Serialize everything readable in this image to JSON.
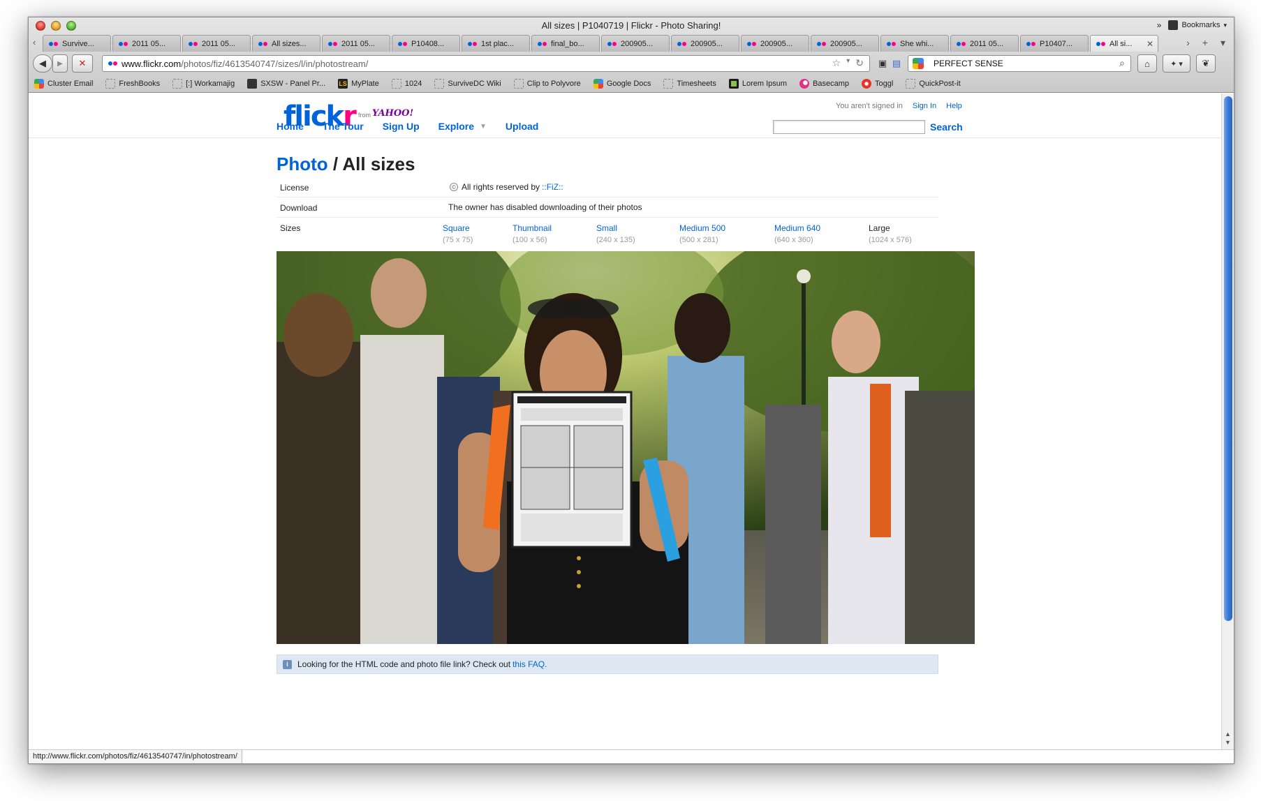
{
  "window": {
    "title": "All sizes | P1040719 | Flickr - Photo Sharing!"
  },
  "tabs": [
    {
      "label": "Survive..."
    },
    {
      "label": "2011 05..."
    },
    {
      "label": "2011 05..."
    },
    {
      "label": "All sizes..."
    },
    {
      "label": "2011 05..."
    },
    {
      "label": "P10408..."
    },
    {
      "label": "1st plac..."
    },
    {
      "label": "final_bo..."
    },
    {
      "label": "200905..."
    },
    {
      "label": "200905..."
    },
    {
      "label": "200905..."
    },
    {
      "label": "200905..."
    },
    {
      "label": "She whi..."
    },
    {
      "label": "2011 05..."
    },
    {
      "label": "P10407..."
    },
    {
      "label": "All si..."
    }
  ],
  "url": {
    "host": "www.flickr.com",
    "path": "/photos/fiz/4613540747/sizes/l/in/photostream/"
  },
  "search": {
    "value": "PERFECT SENSE"
  },
  "bookmarks": [
    {
      "label": "Cluster Email",
      "icon": "google-icon"
    },
    {
      "label": "FreshBooks",
      "icon": "bookmark-icon"
    },
    {
      "label": "[:] Workamajig",
      "icon": "workamajig-icon"
    },
    {
      "label": "SXSW - Panel Pr...",
      "icon": "sxsw-icon"
    },
    {
      "label": "MyPlate",
      "icon": "ls-icon"
    },
    {
      "label": "1024",
      "icon": "bookmark-icon"
    },
    {
      "label": "SurviveDC Wiki",
      "icon": "bookmark-icon"
    },
    {
      "label": "Clip to Polyvore",
      "icon": "bookmark-icon"
    },
    {
      "label": "Google Docs",
      "icon": "google-icon"
    },
    {
      "label": "Timesheets",
      "icon": "bookmark-icon"
    },
    {
      "label": "Lorem Ipsum",
      "icon": "lorem-icon"
    },
    {
      "label": "Basecamp",
      "icon": "basecamp-icon"
    },
    {
      "label": "Toggl",
      "icon": "toggl-icon"
    },
    {
      "label": "QuickPost-it",
      "icon": "bookmark-icon"
    }
  ],
  "bookmarks_menu": "Bookmarks",
  "flickr": {
    "logo_a": "flick",
    "logo_b": "r",
    "from": "from",
    "yahoo": "YAHOO!",
    "signed_out": "You aren't signed in",
    "sign_in": "Sign In",
    "help": "Help",
    "nav": [
      "Home",
      "The Tour",
      "Sign Up",
      "Explore",
      "Upload"
    ],
    "search_button": "Search"
  },
  "page": {
    "crumb": "Photo",
    "sep": " / ",
    "title": "All sizes",
    "license_label": "License",
    "license_text": "All rights reserved by",
    "owner": "::FiZ::",
    "download_label": "Download",
    "download_text": "The owner has disabled downloading of their photos",
    "sizes_label": "Sizes",
    "sizes": [
      {
        "label": "Square",
        "dim": "(75 x 75)"
      },
      {
        "label": "Thumbnail",
        "dim": "(100 x 56)"
      },
      {
        "label": "Small",
        "dim": "(240 x 135)"
      },
      {
        "label": "Medium 500",
        "dim": "(500 x 281)"
      },
      {
        "label": "Medium 640",
        "dim": "(640 x 360)"
      },
      {
        "label": "Large",
        "dim": "(1024 x 576)"
      }
    ],
    "faq_text": "Looking for the HTML code and photo file link? Check out",
    "faq_link": "this FAQ."
  },
  "status_url": "http://www.flickr.com/photos/fiz/4613540747/in/photostream/",
  "colors": {
    "flickr_blue": "#0063dc",
    "flickr_pink": "#ff0084",
    "scroll_blue": "#3a7ad8"
  }
}
